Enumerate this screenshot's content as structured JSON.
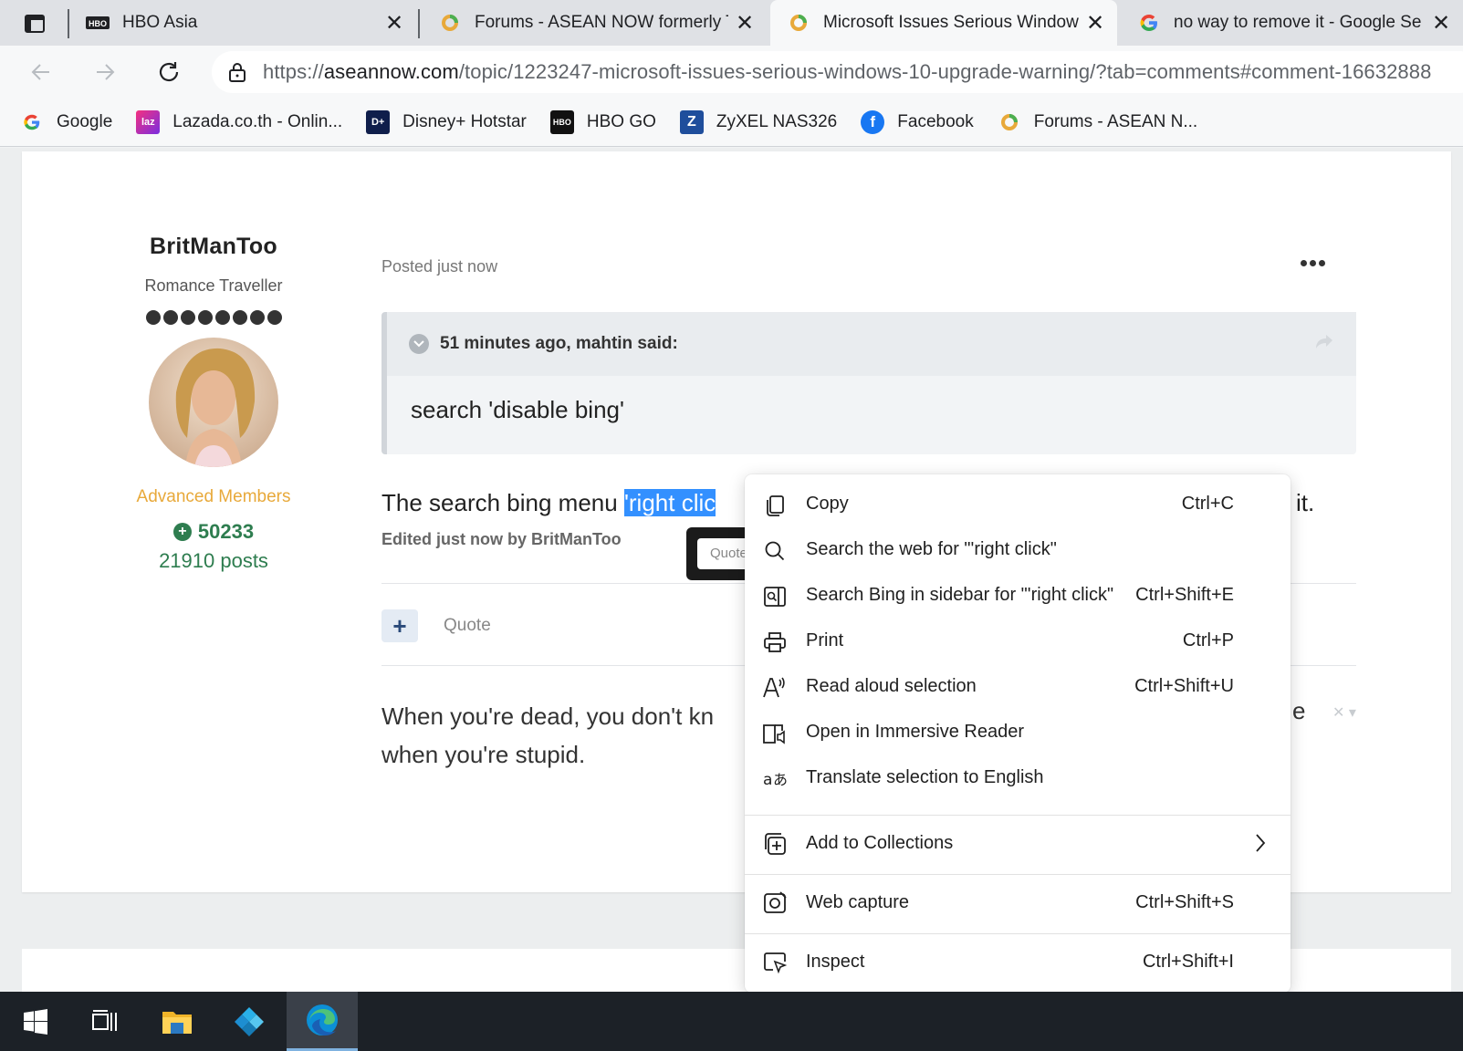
{
  "browser": {
    "tabs": [
      {
        "title": "HBO Asia",
        "icon": "hbo-icon",
        "active": false
      },
      {
        "title": "Forums - ASEAN NOW formerly T",
        "icon": "aseannow-icon",
        "active": false
      },
      {
        "title": "Microsoft Issues Serious Window",
        "icon": "aseannow-icon",
        "active": true
      },
      {
        "title": "no way to remove it - Google Se",
        "icon": "google-icon",
        "active": false
      }
    ],
    "close_glyph": "✕",
    "url_scheme": "https://",
    "url_domain": "aseannow.com",
    "url_path": "/topic/1223247-microsoft-issues-serious-windows-10-upgrade-warning/?tab=comments#comment-16632888",
    "favorites": [
      {
        "label": "Google",
        "icon": "google-icon"
      },
      {
        "label": "Lazada.co.th - Onlin...",
        "icon": "lazada-icon"
      },
      {
        "label": "Disney+ Hotstar",
        "icon": "disney-hotstar-icon"
      },
      {
        "label": "HBO GO",
        "icon": "hbo-go-icon"
      },
      {
        "label": "ZyXEL NAS326",
        "icon": "zyxel-icon"
      },
      {
        "label": "Facebook",
        "icon": "facebook-icon"
      },
      {
        "label": "Forums - ASEAN N...",
        "icon": "aseannow-icon"
      }
    ]
  },
  "post": {
    "author_name": "BritManToo",
    "author_title": "Romance Traveller",
    "group": "Advanced Members",
    "reputation": "50233",
    "posts": "21910 posts",
    "posted": "Posted just now",
    "quote_header": "51 minutes ago, mahtin said:",
    "quote_text": "search 'disable bing'",
    "text_before": "The search bing menu ",
    "text_selected": "'right clic",
    "text_tail": "it.",
    "edited": "Edited just now by BritManToo",
    "quote_tooltip": "Quote",
    "plus_label": "+",
    "quote_link": "Quote",
    "signature": "When you're dead, you don't kn",
    "signature_line2": "when you're stupid.",
    "signature_tail": "e",
    "signature_close": "✕ ▾"
  },
  "context_menu": {
    "items": [
      {
        "label": "Copy",
        "shortcut": "Ctrl+C",
        "icon": "copy-icon"
      },
      {
        "label": "Search the web for \"'right click\"",
        "shortcut": "",
        "icon": "search-icon"
      },
      {
        "label": "Search Bing in sidebar for \"'right click\"",
        "shortcut": "Ctrl+Shift+E",
        "icon": "sidebar-search-icon"
      },
      {
        "label": "Print",
        "shortcut": "Ctrl+P",
        "icon": "print-icon"
      },
      {
        "label": "Read aloud selection",
        "shortcut": "Ctrl+Shift+U",
        "icon": "read-aloud-icon"
      },
      {
        "label": "Open in Immersive Reader",
        "shortcut": "",
        "icon": "immersive-reader-icon"
      },
      {
        "label": "Translate selection to English",
        "shortcut": "",
        "icon": "translate-icon"
      },
      {
        "label": "Add to Collections",
        "shortcut": "",
        "icon": "collections-icon"
      },
      {
        "label": "Web capture",
        "shortcut": "Ctrl+Shift+S",
        "icon": "web-capture-icon"
      },
      {
        "label": "Inspect",
        "shortcut": "Ctrl+Shift+I",
        "icon": "inspect-icon"
      }
    ]
  },
  "taskbar": {
    "items": [
      "windows-start-icon",
      "task-view-icon",
      "file-explorer-icon",
      "kodi-icon",
      "edge-icon"
    ]
  },
  "colors": {
    "selection": "#3390ff",
    "reputation_green": "#2e7d4f",
    "group_orange": "#e8a93a"
  }
}
